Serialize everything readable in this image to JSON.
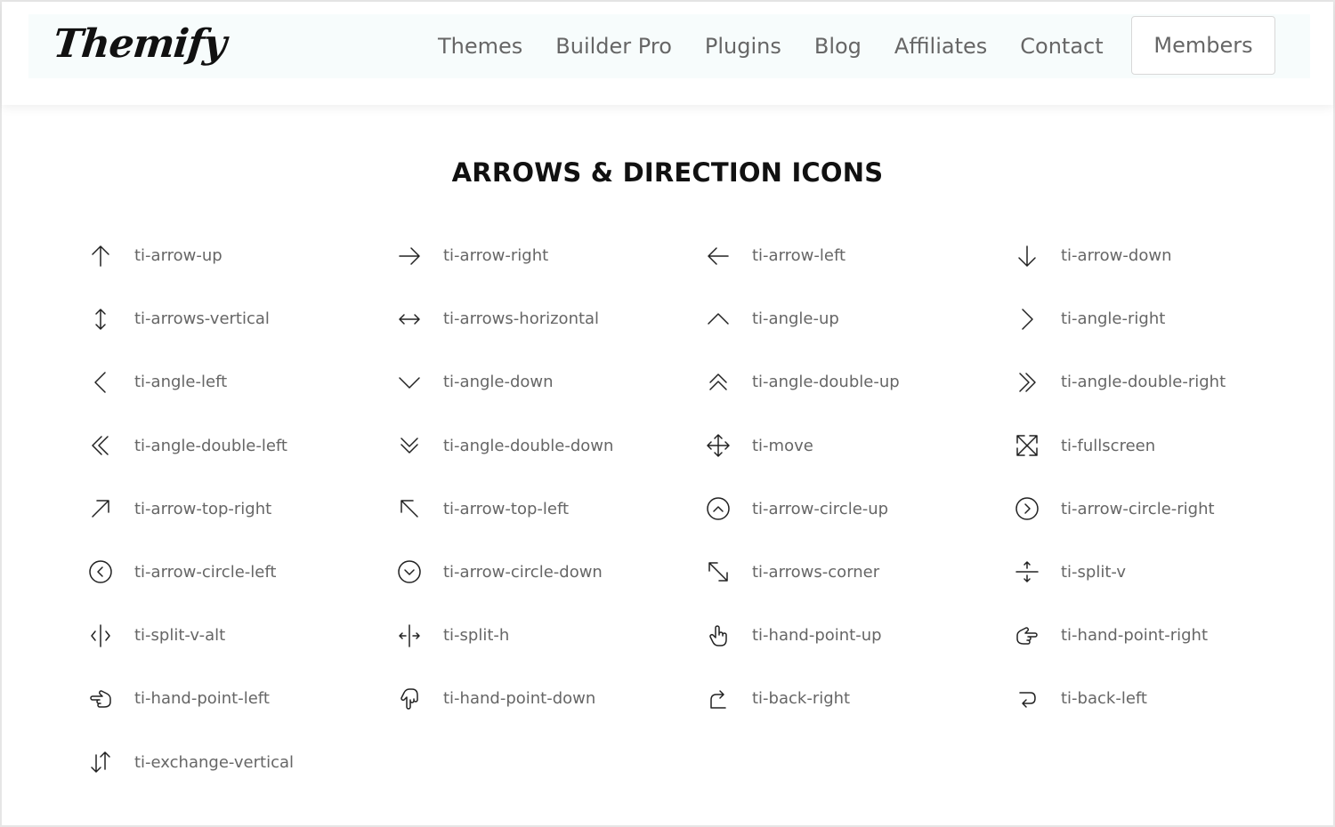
{
  "header": {
    "logo": "Themify",
    "nav": [
      "Themes",
      "Builder Pro",
      "Plugins",
      "Blog",
      "Affiliates",
      "Contact"
    ],
    "members": "Members"
  },
  "section": {
    "title": "ARROWS & DIRECTION ICONS"
  },
  "icons": [
    {
      "label": "ti-arrow-up",
      "icon": "arrow-up-icon"
    },
    {
      "label": "ti-arrow-right",
      "icon": "arrow-right-icon"
    },
    {
      "label": "ti-arrow-left",
      "icon": "arrow-left-icon"
    },
    {
      "label": "ti-arrow-down",
      "icon": "arrow-down-icon"
    },
    {
      "label": "ti-arrows-vertical",
      "icon": "arrows-vertical-icon"
    },
    {
      "label": "ti-arrows-horizontal",
      "icon": "arrows-horizontal-icon"
    },
    {
      "label": "ti-angle-up",
      "icon": "angle-up-icon"
    },
    {
      "label": "ti-angle-right",
      "icon": "angle-right-icon"
    },
    {
      "label": "ti-angle-left",
      "icon": "angle-left-icon"
    },
    {
      "label": "ti-angle-down",
      "icon": "angle-down-icon"
    },
    {
      "label": "ti-angle-double-up",
      "icon": "angle-double-up-icon"
    },
    {
      "label": "ti-angle-double-right",
      "icon": "angle-double-right-icon"
    },
    {
      "label": "ti-angle-double-left",
      "icon": "angle-double-left-icon"
    },
    {
      "label": "ti-angle-double-down",
      "icon": "angle-double-down-icon"
    },
    {
      "label": "ti-move",
      "icon": "move-icon"
    },
    {
      "label": "ti-fullscreen",
      "icon": "fullscreen-icon"
    },
    {
      "label": "ti-arrow-top-right",
      "icon": "arrow-top-right-icon"
    },
    {
      "label": "ti-arrow-top-left",
      "icon": "arrow-top-left-icon"
    },
    {
      "label": "ti-arrow-circle-up",
      "icon": "arrow-circle-up-icon"
    },
    {
      "label": "ti-arrow-circle-right",
      "icon": "arrow-circle-right-icon"
    },
    {
      "label": "ti-arrow-circle-left",
      "icon": "arrow-circle-left-icon"
    },
    {
      "label": "ti-arrow-circle-down",
      "icon": "arrow-circle-down-icon"
    },
    {
      "label": "ti-arrows-corner",
      "icon": "arrows-corner-icon"
    },
    {
      "label": "ti-split-v",
      "icon": "split-v-icon"
    },
    {
      "label": "ti-split-v-alt",
      "icon": "split-v-alt-icon"
    },
    {
      "label": "ti-split-h",
      "icon": "split-h-icon"
    },
    {
      "label": "ti-hand-point-up",
      "icon": "hand-point-up-icon"
    },
    {
      "label": "ti-hand-point-right",
      "icon": "hand-point-right-icon"
    },
    {
      "label": "ti-hand-point-left",
      "icon": "hand-point-left-icon"
    },
    {
      "label": "ti-hand-point-down",
      "icon": "hand-point-down-icon"
    },
    {
      "label": "ti-back-right",
      "icon": "back-right-icon"
    },
    {
      "label": "ti-back-left",
      "icon": "back-left-icon"
    },
    {
      "label": "ti-exchange-vertical",
      "icon": "exchange-vertical-icon"
    }
  ],
  "colors": {
    "header_bg": "#f7fcfc",
    "nav_text": "#666666",
    "label_text": "#666666",
    "title_text": "#111111"
  }
}
